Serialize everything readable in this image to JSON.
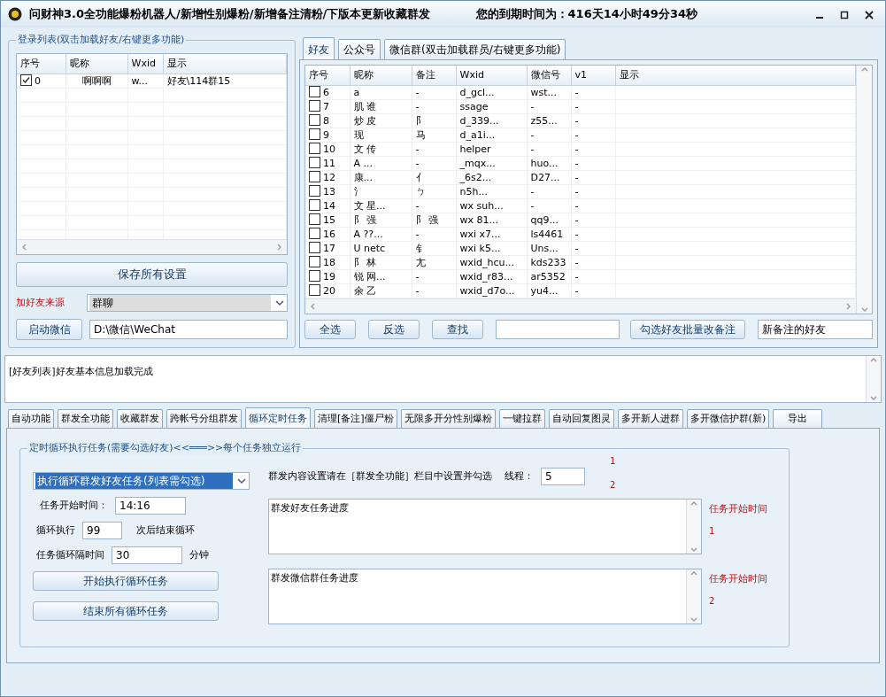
{
  "window": {
    "title": "问财神3.0全功能爆粉机器人/新增性别爆粉/新增备注清粉/下版本更新收藏群发",
    "expiry": "您的到期时间为：416天14小时49分34秒"
  },
  "login_list": {
    "title": "登录列表(双击加载好友/右键更多功能)",
    "columns": [
      "序号",
      "昵称",
      "Wxid",
      "显示"
    ],
    "rows": [
      {
        "checked": true,
        "cells": [
          "0",
          "啊啊啊",
          "w...",
          "好友\\114群15"
        ]
      }
    ]
  },
  "save_button": "保存所有设置",
  "source_label": "加好友来源",
  "source_select": "群聊",
  "start_wechat_button": "启动微信",
  "wechat_path": "D:\\微信\\WeChat",
  "friend_tabs": [
    {
      "label": "好友",
      "selected": true
    },
    {
      "label": "公众号",
      "selected": false
    },
    {
      "label": "微信群(双击加载群员/右键更多功能)",
      "selected": false
    }
  ],
  "friends": {
    "columns": [
      "序号",
      "昵称",
      "备注",
      "Wxid",
      "微信号",
      "v1",
      "显示"
    ],
    "rows": [
      {
        "checked": false,
        "cells": [
          "6",
          "a",
          "-",
          "d_gcl...",
          "wst...",
          "-"
        ]
      },
      {
        "checked": false,
        "cells": [
          "7",
          "肌 谁",
          "-",
          "ssage",
          "-",
          "-"
        ]
      },
      {
        "checked": false,
        "cells": [
          "8",
          "炒 皮",
          "阝",
          "d_339...",
          "z55...",
          "-"
        ]
      },
      {
        "checked": false,
        "cells": [
          "9",
          "现",
          "马",
          "d_a1i...",
          "-",
          "-"
        ]
      },
      {
        "checked": false,
        "cells": [
          "10",
          "文 传",
          "-",
          "helper",
          "-",
          "-"
        ]
      },
      {
        "checked": false,
        "cells": [
          "11",
          "A ...",
          "-",
          "_mqx...",
          "huo...",
          "-"
        ]
      },
      {
        "checked": false,
        "cells": [
          "12",
          "康...",
          "亻",
          "_6s2...",
          "D27...",
          "-"
        ]
      },
      {
        "checked": false,
        "cells": [
          "13",
          "氵",
          "ㄅ",
          "n5h...",
          "-",
          "-"
        ]
      },
      {
        "checked": false,
        "cells": [
          "14",
          "文 星...",
          "-",
          "wx suh...",
          "-",
          "-"
        ]
      },
      {
        "checked": false,
        "cells": [
          "15",
          "阝 强",
          "阝 强",
          "wx 81...",
          "qq9...",
          "-"
        ]
      },
      {
        "checked": false,
        "cells": [
          "16",
          "A ??...",
          "-",
          "wxi x7...",
          "ls4461",
          "-"
        ]
      },
      {
        "checked": false,
        "cells": [
          "17",
          "U netc",
          "钅",
          "wxi k5...",
          "Uns...",
          "-"
        ]
      },
      {
        "checked": false,
        "cells": [
          "18",
          "阝 林",
          "尢",
          "wxid_hcu...",
          "kds233",
          "-"
        ]
      },
      {
        "checked": false,
        "cells": [
          "19",
          "锐 网...",
          "-",
          "wxid_r83...",
          "ar5352",
          "-"
        ]
      },
      {
        "checked": false,
        "cells": [
          "20",
          "余 乙",
          "-",
          "wxid_d7o...",
          "yu4...",
          "-"
        ]
      }
    ]
  },
  "friend_buttons": [
    "全选",
    "反选",
    "查找"
  ],
  "batch_remark_button": "勾选好友批量改备注",
  "new_remark": "新备注的好友",
  "log": "[好友列表]好友基本信息加载完成",
  "main_tabs": [
    {
      "label": "自动功能",
      "selected": false
    },
    {
      "label": "群发全功能",
      "selected": false
    },
    {
      "label": "收藏群发",
      "selected": false
    },
    {
      "label": "跨帐号分组群发",
      "selected": false
    },
    {
      "label": "循环定时任务",
      "selected": true
    },
    {
      "label": "清理[备注]僵尸粉",
      "selected": false
    },
    {
      "label": "无限多开分性别爆粉",
      "selected": false
    },
    {
      "label": "一键拉群",
      "selected": false
    },
    {
      "label": "自动回复图灵",
      "selected": false
    },
    {
      "label": "多开新人进群",
      "selected": false
    },
    {
      "label": "多开微信护群(新)",
      "selected": false
    },
    {
      "label": "导出",
      "selected": false
    }
  ],
  "loop_task": {
    "group_title": "定时循环执行任务(需要勾选好友)<<═══>>每个任务独立运行",
    "task_select": "执行循环群发好友任务(列表需勾选)",
    "content_hint": "群发内容设置请在［群发全功能］栏目中设置并勾选",
    "threads_label": "线程：",
    "threads": "5",
    "marks": [
      "1",
      "2"
    ],
    "start_time_label": "任务开始时间：",
    "start_time": "14:16",
    "loop_label": "循环执行",
    "loop_count": "99",
    "loop_suffix": "次后结束循环",
    "interval_label": "任务循环隔时间",
    "interval": "30",
    "interval_unit": "分钟",
    "start_button": "开始执行循环任务",
    "stop_button": "结束所有循环任务",
    "progress": [
      {
        "text": "群发好友任务进度",
        "side_label": "任务开始时间",
        "index": "1"
      },
      {
        "text": "群发微信群任务进度",
        "side_label": "任务开始时间",
        "index": "2"
      }
    ]
  }
}
